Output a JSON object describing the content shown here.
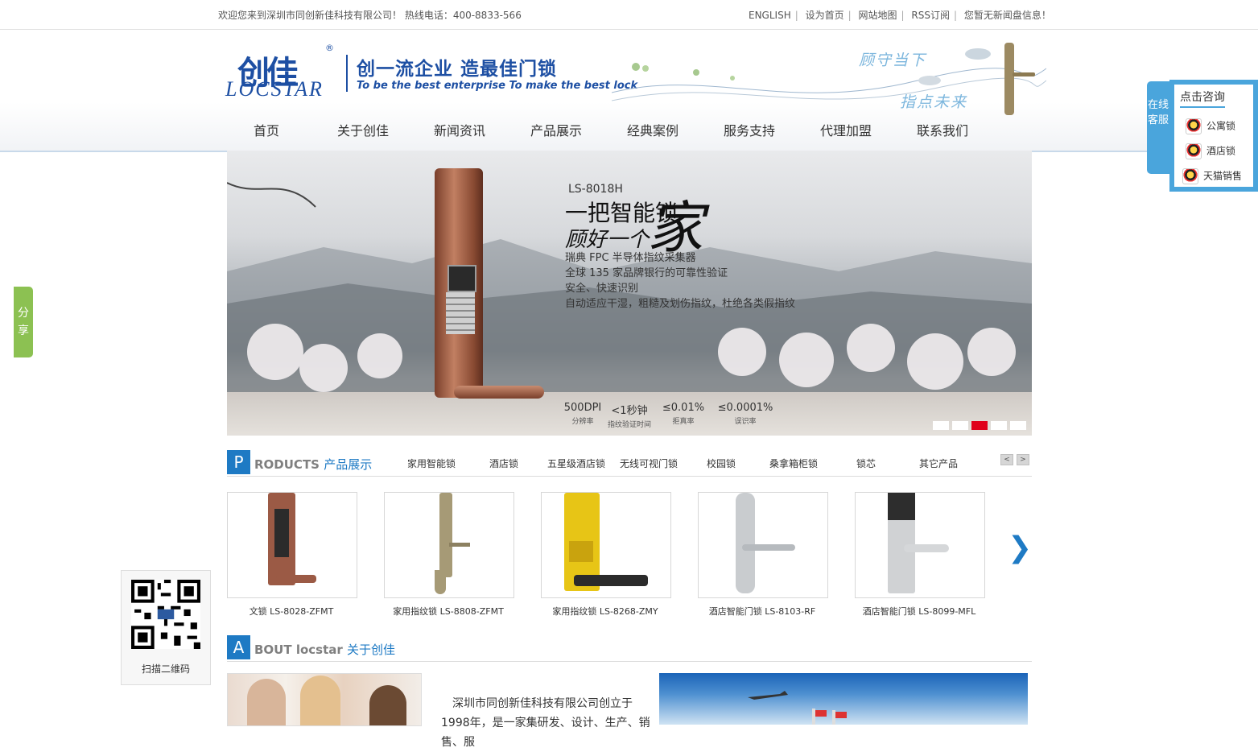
{
  "topbar": {
    "welcome": "欢迎您来到深圳市同创新佳科技有限公司！ 热线电话：400-8833-566",
    "links": [
      "ENGLISH",
      "设为首页",
      "网站地图",
      "RSS订阅",
      "您暂无新闻盘信息！"
    ]
  },
  "header": {
    "logo_zh": "创佳",
    "logo_reg": "®",
    "logo_en": "LOCSTAR",
    "slogan_zh": "创一流企业 造最佳门锁",
    "slogan_en": "To be the best enterprise To make the best lock",
    "tag1": "顾守当下",
    "tag2": "指点未来"
  },
  "nav": [
    "首页",
    "关于创佳",
    "新闻资讯",
    "产品展示",
    "经典案例",
    "服务支持",
    "代理加盟",
    "联系我们"
  ],
  "banner": {
    "model": "LS-8018H",
    "headline": "一把智能锁",
    "headline2": "顾好一个",
    "bigchar": "家",
    "features": [
      "瑞典 FPC 半导体指纹采集器",
      "全球 135 家品牌银行的可靠性验证",
      "安全、快速识别",
      "自动适应干湿，粗糙及划伤指纹，杜绝各类假指纹"
    ],
    "stats": [
      {
        "value": "500DPI",
        "label": "分辨率"
      },
      {
        "value": "<1秒钟",
        "label": "指纹验证时间"
      },
      {
        "value": "≤0.01%",
        "label": "拒真率"
      },
      {
        "value": "≤0.0001%",
        "label": "误识率"
      }
    ],
    "slides": 5,
    "active_slide": 3
  },
  "products_section": {
    "letter": "P",
    "title_en": "RODUCTS",
    "title_zh": "产品展示",
    "categories": [
      "家用智能锁",
      "酒店锁",
      "五星级酒店锁",
      "无线可视门锁",
      "校园锁",
      "桑拿箱柜锁",
      "锁芯",
      "其它产品"
    ],
    "prev": "<",
    "next": ">",
    "big_prev": "❮",
    "big_next": "❯",
    "items": [
      {
        "caption": "文锁 LS-8028-ZFMT",
        "color": "#9b5a45"
      },
      {
        "caption": "家用指纹锁 LS-8808-ZFMT",
        "color": "#a69a76"
      },
      {
        "caption": "家用指纹锁 LS-8268-ZMY",
        "color": "#e7c516"
      },
      {
        "caption": "酒店智能门锁 LS-8103-RF",
        "color": "#c9cccf"
      },
      {
        "caption": "酒店智能门锁 LS-8099-MFL",
        "color": "#2d2d2d"
      }
    ]
  },
  "about_section": {
    "letter": "A",
    "title_en": "BOUT locstar",
    "title_zh": "关于创佳",
    "text": "深圳市同创新佳科技有限公司创立于1998年，是一家集研发、设计、生产、销售、服"
  },
  "share": {
    "label": "分享"
  },
  "kefu": {
    "tab_label": "在线客服",
    "title": "点击咨询",
    "items": [
      "公寓锁",
      "酒店锁",
      "天猫销售"
    ]
  },
  "qr": {
    "label": "扫描二维码"
  },
  "colors": {
    "accent": "#1e7ac4",
    "brand": "#1d4fa3",
    "kefu": "#4aa5dc",
    "share": "#8cc152",
    "active_dot": "#e0001b"
  }
}
